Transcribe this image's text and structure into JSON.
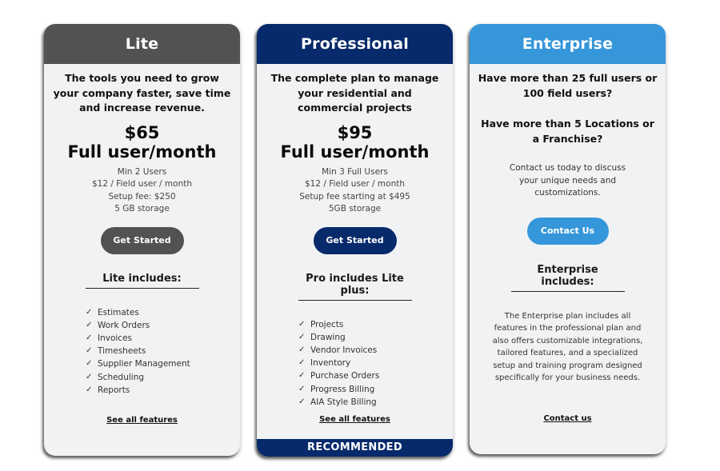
{
  "plans": {
    "lite": {
      "name": "Lite",
      "header_color": "#525252",
      "tagline": "The tools you need to grow your company faster, save time and increase revenue.",
      "price": "$65",
      "price_unit": "Full user/month",
      "details": [
        "Min 2 Users",
        "$12 / Field user / month",
        "Setup fee: $250",
        "5 GB storage"
      ],
      "cta_label": "Get Started",
      "includes_title": "Lite includes:",
      "features": [
        "Estimates",
        "Work Orders",
        "Invoices",
        "Timesheets",
        "Supplier Management",
        "Scheduling",
        "Reports"
      ],
      "link_label": "See all features"
    },
    "professional": {
      "name": "Professional",
      "header_color": "#062a6b",
      "tagline": "The complete plan to manage your residential and commercial projects",
      "price": "$95",
      "price_unit": "Full user/month",
      "details": [
        "Min 3 Full Users",
        "$12 / Field user / month",
        "Setup fee starting at $495",
        "5GB storage"
      ],
      "cta_label": "Get Started",
      "includes_title": "Pro includes Lite plus:",
      "features": [
        "Projects",
        "Drawing",
        "Vendor Invoices",
        "Inventory",
        "Purchase Orders",
        "Progress Billing",
        "AIA Style Billing"
      ],
      "link_label": "See all features",
      "badge": "RECOMMENDED"
    },
    "enterprise": {
      "name": "Enterprise",
      "header_color": "#3596da",
      "question_1": "Have more than 25 full users or 100 field users?",
      "question_2": "Have more than 5 Locations or a Franchise?",
      "contact_text": "Contact us today to discuss your unique needs and customizations.",
      "cta_label": "Contact Us",
      "includes_title": "Enterprise includes:",
      "description": "The Enterprise plan includes all features in the professional plan and also offers customizable integrations, tailored features, and a specialized setup and training program designed specifically for your business needs.",
      "link_label": "Contact us"
    }
  },
  "icons": {
    "feature_check": "✓"
  }
}
